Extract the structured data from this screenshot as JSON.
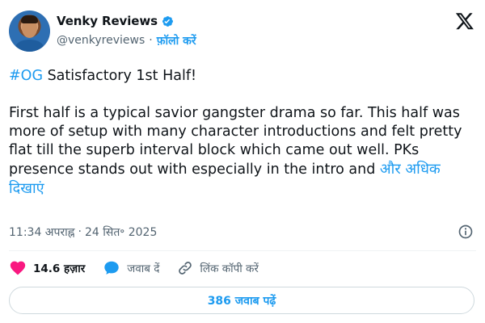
{
  "author": {
    "name": "Venky Reviews",
    "handle": "@venkyreviews",
    "separator": "·",
    "follow_label": "फ़ॉलो करें"
  },
  "tweet": {
    "hashtag": "#OG",
    "line1_rest": " Satisfactory 1st Half!",
    "body": "First half is a typical savior gangster drama so far. This half was more of setup with many character introductions and felt pretty flat till the superb interval block which came out well. PKs presence stands out with especially in the intro and ",
    "show_more": "और अधिक दिखाएं"
  },
  "meta": {
    "time": "11:34 अपराह्न",
    "separator": "·",
    "date": "24 सित॰ 2025"
  },
  "actions": {
    "likes": "14.6 हज़ार",
    "reply_label": "जवाब दें",
    "copy_link_label": "लिंक कॉपी करें"
  },
  "read_replies": "386 जवाब पढ़ें",
  "colors": {
    "accent": "#1d9bf0",
    "like": "#f91880",
    "text": "#0f1419",
    "muted": "#536471"
  },
  "icons": [
    "verified-badge-icon",
    "x-logo-icon",
    "info-icon",
    "heart-icon",
    "reply-bubble-icon",
    "link-icon"
  ]
}
